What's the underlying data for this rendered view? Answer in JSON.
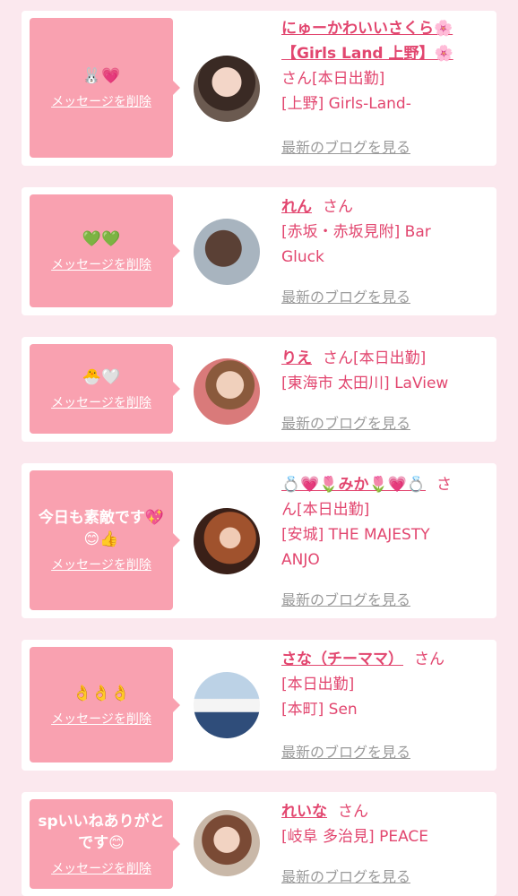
{
  "delete_label": "メッセージを削除",
  "blog_label": "最新のブログを見る",
  "san_label": "さん",
  "items": [
    {
      "message": "🐰💗",
      "name_line1": "にゅーかわいいさくら🌸",
      "name_line2": "【Girls Land 上野】🌸",
      "status_line": "さん[本日出勤]",
      "shop_line1": "[上野] Girls-Land-",
      "shop_line2": ""
    },
    {
      "message": "💚💚",
      "name": "れん",
      "shop_line1": "[赤坂・赤坂見附] Bar",
      "shop_line2": "Gluck"
    },
    {
      "message": "🐣🤍",
      "name": "りえ",
      "status": "[本日出勤]",
      "shop_line1": "[東海市 太田川] LaView"
    },
    {
      "message_line1": "今日も素敵です💖",
      "message_line2": "😊👍",
      "name": "💍💗🌷みか🌷💗💍",
      "status_line": "ん[本日出勤]",
      "san_prefix": "さ",
      "shop_line1": "[安城] THE MAJESTY",
      "shop_line2": "ANJO"
    },
    {
      "message": "👌👌👌",
      "name": "さな（チーママ）",
      "status_line": "[本日出勤]",
      "shop_line1": "[本町] Sen"
    },
    {
      "message_line1": "spいいねありがと",
      "message_line2": "です😊",
      "name": "れいな",
      "shop_line1": "[岐阜 多治見] PEACE"
    }
  ]
}
